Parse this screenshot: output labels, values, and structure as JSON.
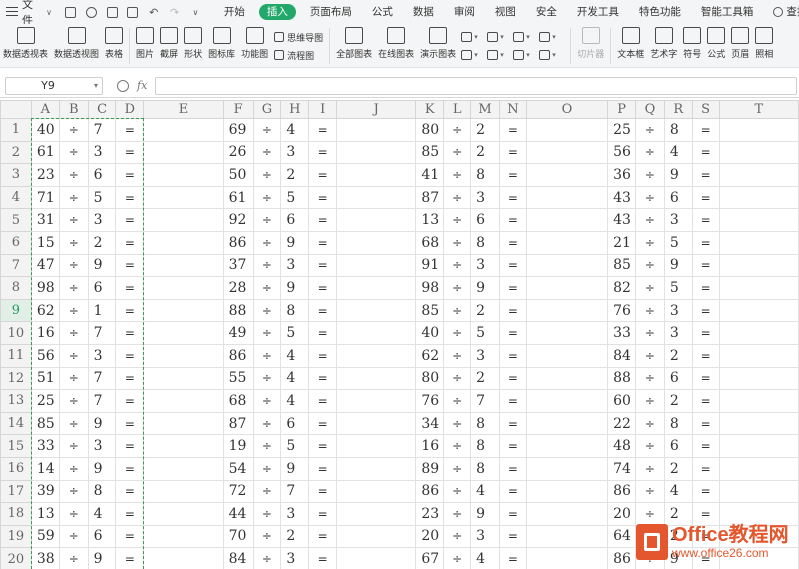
{
  "menubar": {
    "file_label": "文件",
    "tabs": [
      "开始",
      "插入",
      "页面布局",
      "公式",
      "数据",
      "审阅",
      "视图",
      "安全",
      "开发工具",
      "特色功能",
      "智能工具箱"
    ],
    "active_tab": "插入",
    "search_label": "查找",
    "accent_color": "#23a86b"
  },
  "ribbon": {
    "buttons": [
      {
        "label": "数据透视表",
        "icon": "pivot-table-icon"
      },
      {
        "label": "数据透视图",
        "icon": "pivot-chart-icon"
      },
      {
        "label": "表格",
        "icon": "table-icon"
      },
      {
        "label": "图片",
        "icon": "picture-icon"
      },
      {
        "label": "截屏",
        "icon": "screenshot-icon"
      },
      {
        "label": "形状",
        "icon": "shape-icon"
      },
      {
        "label": "图标库",
        "icon": "icon-library-icon"
      },
      {
        "label": "功能图",
        "icon": "function-chart-icon"
      },
      {
        "label": "全部图表",
        "icon": "all-charts-icon"
      },
      {
        "label": "在线图表",
        "icon": "online-chart-icon"
      },
      {
        "label": "演示图表",
        "icon": "demo-chart-icon"
      },
      {
        "label": "切片器",
        "icon": "slicer-icon"
      },
      {
        "label": "文本框",
        "icon": "textbox-icon"
      },
      {
        "label": "艺术字",
        "icon": "wordart-icon"
      },
      {
        "label": "符号",
        "icon": "symbol-icon"
      },
      {
        "label": "公式",
        "icon": "equation-icon"
      },
      {
        "label": "页眉",
        "icon": "header-icon"
      },
      {
        "label": "照相",
        "icon": "camera-icon"
      }
    ],
    "mind_map_label": "思维导图",
    "flowchart_label": "流程图"
  },
  "formula_bar": {
    "cell_ref": "Y9",
    "fx_label": "fx",
    "formula": ""
  },
  "sheet": {
    "selected_row": 9,
    "columns": [
      "A",
      "B",
      "C",
      "D",
      "E",
      "F",
      "G",
      "H",
      "I",
      "J",
      "K",
      "L",
      "M",
      "N",
      "O",
      "P",
      "Q",
      "R",
      "S",
      "T"
    ],
    "op_symbol": "÷",
    "eq_symbol": "=",
    "rows": [
      {
        "n": "1",
        "g": [
          [
            "40",
            "7"
          ],
          [
            "69",
            "4"
          ],
          [
            "80",
            "2"
          ],
          [
            "25",
            "8"
          ]
        ]
      },
      {
        "n": "2",
        "g": [
          [
            "61",
            "3"
          ],
          [
            "26",
            "3"
          ],
          [
            "85",
            "2"
          ],
          [
            "56",
            "4"
          ]
        ]
      },
      {
        "n": "3",
        "g": [
          [
            "23",
            "6"
          ],
          [
            "50",
            "2"
          ],
          [
            "41",
            "8"
          ],
          [
            "36",
            "9"
          ]
        ]
      },
      {
        "n": "4",
        "g": [
          [
            "71",
            "5"
          ],
          [
            "61",
            "5"
          ],
          [
            "87",
            "3"
          ],
          [
            "43",
            "6"
          ]
        ]
      },
      {
        "n": "5",
        "g": [
          [
            "31",
            "3"
          ],
          [
            "92",
            "6"
          ],
          [
            "13",
            "6"
          ],
          [
            "43",
            "3"
          ]
        ]
      },
      {
        "n": "6",
        "g": [
          [
            "15",
            "2"
          ],
          [
            "86",
            "9"
          ],
          [
            "68",
            "8"
          ],
          [
            "21",
            "5"
          ]
        ]
      },
      {
        "n": "7",
        "g": [
          [
            "47",
            "9"
          ],
          [
            "37",
            "3"
          ],
          [
            "91",
            "3"
          ],
          [
            "85",
            "9"
          ]
        ]
      },
      {
        "n": "8",
        "g": [
          [
            "98",
            "6"
          ],
          [
            "28",
            "9"
          ],
          [
            "98",
            "9"
          ],
          [
            "82",
            "5"
          ]
        ]
      },
      {
        "n": "9",
        "g": [
          [
            "62",
            "1"
          ],
          [
            "88",
            "8"
          ],
          [
            "85",
            "2"
          ],
          [
            "76",
            "3"
          ]
        ]
      },
      {
        "n": "10",
        "g": [
          [
            "16",
            "7"
          ],
          [
            "49",
            "5"
          ],
          [
            "40",
            "5"
          ],
          [
            "33",
            "3"
          ]
        ]
      },
      {
        "n": "11",
        "g": [
          [
            "56",
            "3"
          ],
          [
            "86",
            "4"
          ],
          [
            "62",
            "3"
          ],
          [
            "84",
            "2"
          ]
        ]
      },
      {
        "n": "12",
        "g": [
          [
            "51",
            "7"
          ],
          [
            "55",
            "4"
          ],
          [
            "80",
            "2"
          ],
          [
            "88",
            "6"
          ]
        ]
      },
      {
        "n": "13",
        "g": [
          [
            "25",
            "7"
          ],
          [
            "68",
            "4"
          ],
          [
            "76",
            "7"
          ],
          [
            "60",
            "2"
          ]
        ]
      },
      {
        "n": "14",
        "g": [
          [
            "85",
            "9"
          ],
          [
            "87",
            "6"
          ],
          [
            "34",
            "8"
          ],
          [
            "22",
            "8"
          ]
        ]
      },
      {
        "n": "15",
        "g": [
          [
            "33",
            "3"
          ],
          [
            "19",
            "5"
          ],
          [
            "16",
            "8"
          ],
          [
            "48",
            "6"
          ]
        ]
      },
      {
        "n": "16",
        "g": [
          [
            "14",
            "9"
          ],
          [
            "54",
            "9"
          ],
          [
            "89",
            "8"
          ],
          [
            "74",
            "2"
          ]
        ]
      },
      {
        "n": "17",
        "g": [
          [
            "39",
            "8"
          ],
          [
            "72",
            "7"
          ],
          [
            "86",
            "4"
          ],
          [
            "86",
            "4"
          ]
        ]
      },
      {
        "n": "18",
        "g": [
          [
            "13",
            "4"
          ],
          [
            "44",
            "3"
          ],
          [
            "23",
            "9"
          ],
          [
            "20",
            "2"
          ]
        ]
      },
      {
        "n": "19",
        "g": [
          [
            "59",
            "6"
          ],
          [
            "70",
            "2"
          ],
          [
            "20",
            "3"
          ],
          [
            "64",
            "2"
          ]
        ]
      },
      {
        "n": "20",
        "g": [
          [
            "38",
            "9"
          ],
          [
            "84",
            "3"
          ],
          [
            "67",
            "4"
          ],
          [
            "86",
            "9"
          ]
        ]
      }
    ]
  },
  "watermark": {
    "title": "Office教程网",
    "url": "www.office26.com",
    "color": "#e4572e"
  }
}
